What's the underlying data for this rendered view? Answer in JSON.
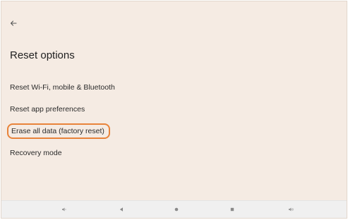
{
  "screen": {
    "back_icon": "arrow-back-icon",
    "title": "Reset options"
  },
  "menu": {
    "items": [
      {
        "label": "Reset Wi-Fi, mobile & Bluetooth"
      },
      {
        "label": "Reset app preferences"
      },
      {
        "label": "Erase all data (factory reset)",
        "highlighted": true
      },
      {
        "label": "Recovery mode"
      }
    ]
  },
  "nav_bar": {
    "icons": [
      "volume-down-icon",
      "back-triangle-icon",
      "home-circle-icon",
      "recents-square-icon",
      "volume-up-icon"
    ]
  },
  "colors": {
    "background": "#f5ebe3",
    "highlight": "#e8833a",
    "nav_bar": "#f0f0f0"
  }
}
